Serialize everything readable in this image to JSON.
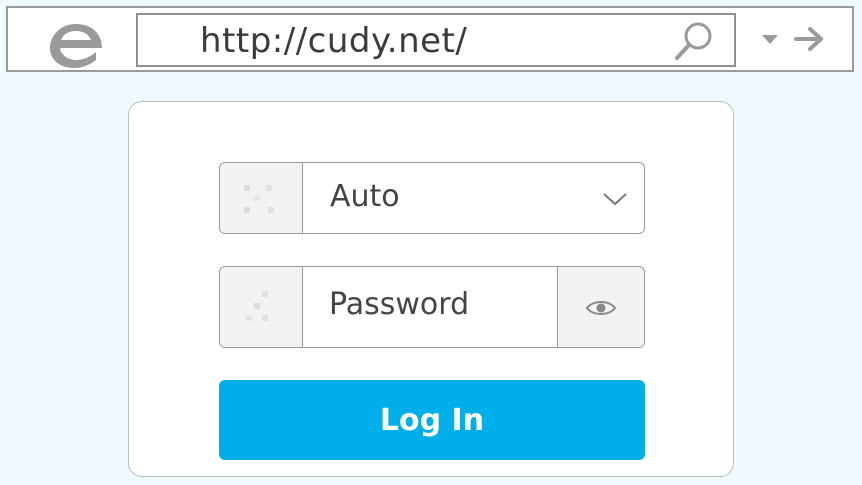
{
  "browser": {
    "url": "http://cudy.net/",
    "icons": {
      "logo": "edge-logo-icon",
      "search": "search-icon",
      "dropdown": "chevron-down-icon",
      "forward": "arrow-right-icon"
    }
  },
  "login": {
    "language": {
      "value": "Auto",
      "icon": "globe-icon",
      "dropdown_icon": "chevron-down-icon"
    },
    "password": {
      "placeholder": "Password",
      "icon": "lock-icon",
      "toggle_icon": "eye-icon"
    },
    "button_label": "Log In"
  },
  "colors": {
    "page_background": "#eefafd",
    "accent": "#00aeea",
    "border": "#9a9a9a"
  }
}
